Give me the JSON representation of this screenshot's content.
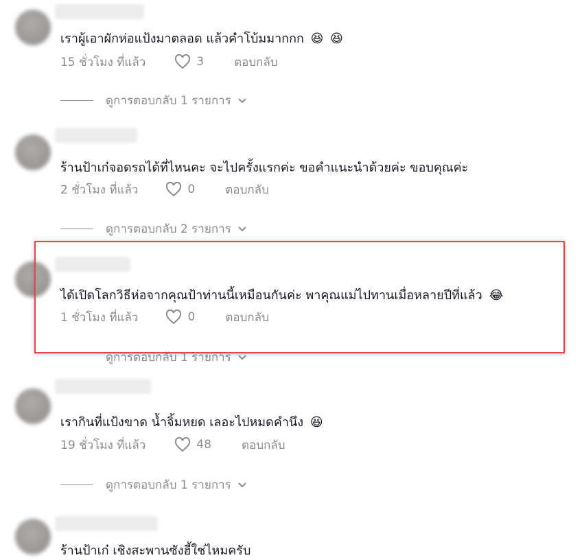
{
  "comments": [
    {
      "text": "เราผู้เอาผักห่อแป้งมาตลอด แล้วคำโบ้มมากกก",
      "emojis": [
        "😆",
        "😆"
      ],
      "time": "15 ชั่วโมง ที่แล้ว",
      "likes": "3",
      "reply_label": "ตอบกลับ",
      "view_replies": "ดูการตอบกลับ 1 รายการ"
    },
    {
      "text": "ร้านป้าเก๋จอดรถได้ที่ไหนคะ จะไปครั้งแรกค่ะ ขอคำแนะนำด้วยค่ะ ขอบคุณค่ะ",
      "emojis": [],
      "time": "2 ชั่วโมง ที่แล้ว",
      "likes": "0",
      "reply_label": "ตอบกลับ",
      "view_replies": "ดูการตอบกลับ 2 รายการ"
    },
    {
      "text": "ได้เปิดโลกวิธีห่อจากคุณป้าท่านนี้เหมือนกันค่ะ พาคุณแม่ไปทานเมื่อหลายปีที่แล้ว",
      "emojis": [
        "😂"
      ],
      "time": "1 ชั่วโมง ที่แล้ว",
      "likes": "0",
      "reply_label": "ตอบกลับ",
      "view_replies": "ดูการตอบกลับ 1 รายการ"
    },
    {
      "text": "เรากินที่แป้งขาด น้ำจิ้มหยด เลอะไปหมดคำนึง",
      "emojis": [
        "😆"
      ],
      "time": "19 ชั่วโมง ที่แล้ว",
      "likes": "48",
      "reply_label": "ตอบกลับ",
      "view_replies": "ดูการตอบกลับ 1 รายการ"
    },
    {
      "text": "ร้านป้าเก๋ เชิงสะพานซังฮี้ใช่ไหมครับ",
      "emojis": []
    }
  ],
  "colors": {
    "text_primary": "#161823",
    "text_secondary": "#8a8b91",
    "highlight_border": "#e0494b"
  }
}
